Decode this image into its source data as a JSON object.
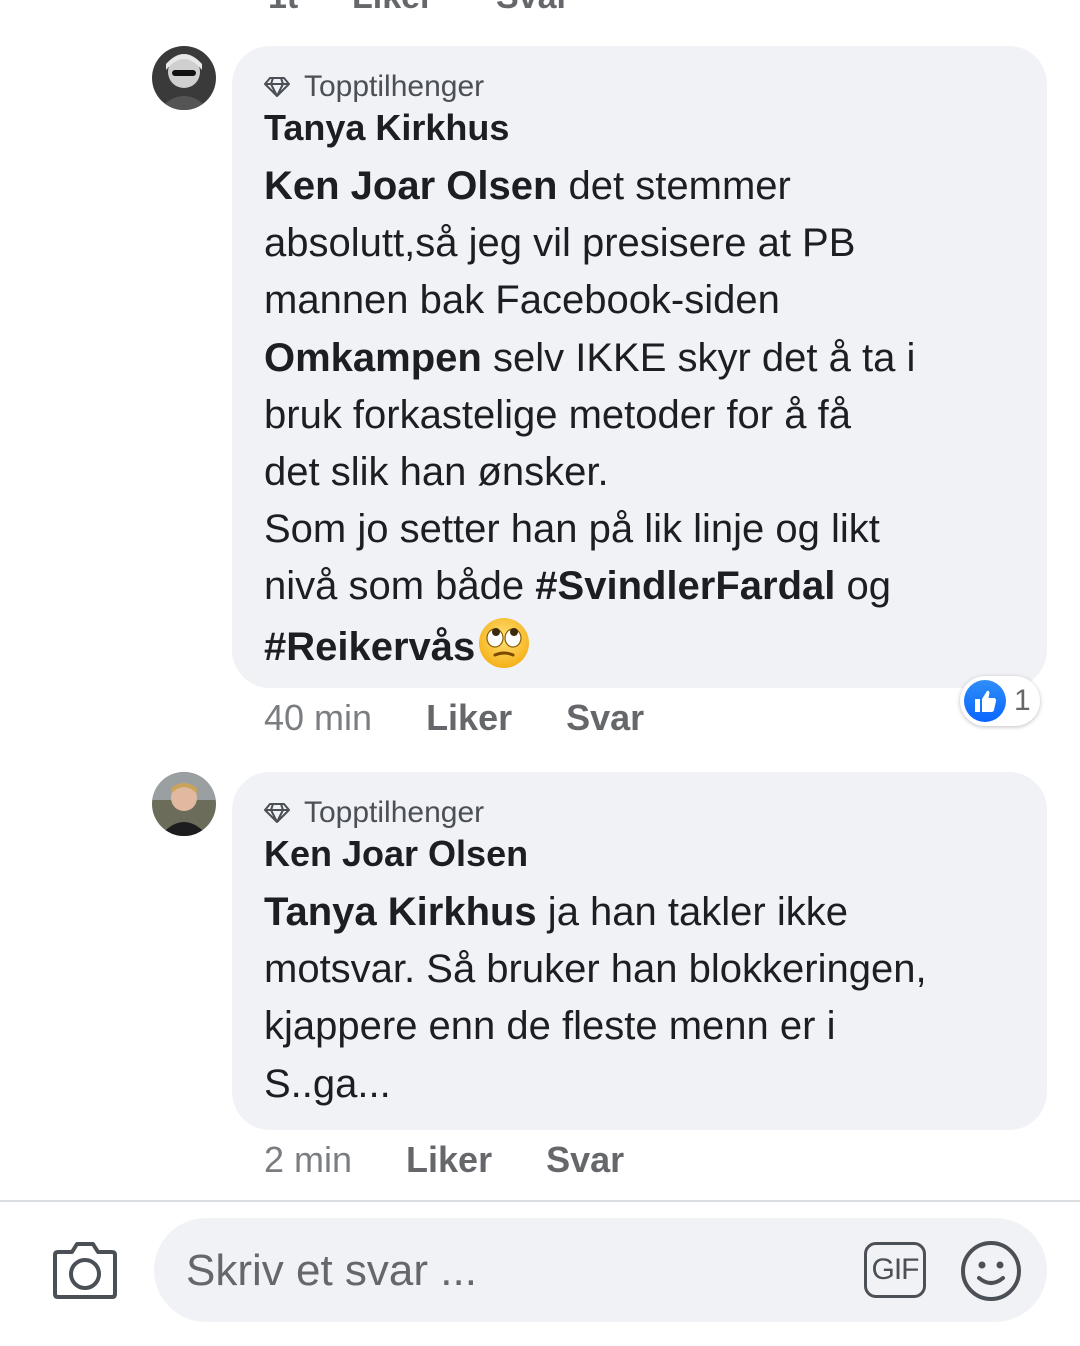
{
  "previous_comment": {
    "actions_partial": [
      "Liker",
      "Svar"
    ]
  },
  "comments": [
    {
      "badge": "Topptilhenger",
      "badge_icon": "diamond-icon",
      "author": "Tanya Kirkhus",
      "text": {
        "mention": "Ken Joar Olsen",
        "line1_rest": " det stemmer",
        "line2": "absolutt,så jeg vil presisere at PB",
        "line3": "mannen bak Facebook-siden",
        "page_name": "Omkampen",
        "line4_rest": " selv IKKE skyr det å ta i",
        "line5": "bruk forkastelige metoder for å få",
        "line6": "det slik han ønsker.",
        "line7": "Som jo setter han på lik linje og likt",
        "line8_start": "nivå som både ",
        "hashtag1": "#SvindlerFardal",
        "line8_end": " og",
        "hashtag2": "#Reikervås",
        "emoji": "face-with-rolling-eyes"
      },
      "time": "40 min",
      "like_label": "Liker",
      "reply_label": "Svar",
      "reaction_icon": "like-icon",
      "reaction_count": "1"
    },
    {
      "badge": "Topptilhenger",
      "badge_icon": "diamond-icon",
      "author": "Ken Joar Olsen",
      "text": {
        "mention": "Tanya Kirkhus",
        "line1_rest": " ja han takler ikke",
        "line2": "motsvar. Så bruker han blokkeringen,",
        "line3": "kjappere enn de fleste menn er i",
        "line4": "S..ga..."
      },
      "time": "2 min",
      "like_label": "Liker",
      "reply_label": "Svar"
    }
  ],
  "composer": {
    "placeholder": "Skriv et svar ...",
    "gif_label": "GIF",
    "camera_icon": "camera-icon",
    "emoji_icon": "smiley-icon"
  },
  "colors": {
    "bubble_bg": "#f0f2f5",
    "text": "#1c1e21",
    "meta": "#65676b",
    "like_blue": "#0866ff"
  }
}
